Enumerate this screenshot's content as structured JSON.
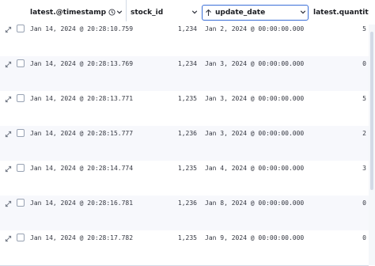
{
  "columns": {
    "timestamp": "latest.@timestamp",
    "stock_id": "stock_id",
    "update_date": "update_date",
    "quantity": "latest.quantity"
  },
  "sort": {
    "column": "update_date",
    "direction": "ascending"
  },
  "rows": [
    {
      "timestamp": "Jan 14, 2024 @ 20:28:10.759",
      "stock_id": "1,234",
      "update_date": "Jan 2, 2024 @ 00:00:00.000",
      "quantity": "5"
    },
    {
      "timestamp": "Jan 14, 2024 @ 20:28:13.769",
      "stock_id": "1,234",
      "update_date": "Jan 3, 2024 @ 00:00:00.000",
      "quantity": "0"
    },
    {
      "timestamp": "Jan 14, 2024 @ 20:28:13.771",
      "stock_id": "1,235",
      "update_date": "Jan 3, 2024 @ 00:00:00.000",
      "quantity": "5"
    },
    {
      "timestamp": "Jan 14, 2024 @ 20:28:15.777",
      "stock_id": "1,236",
      "update_date": "Jan 3, 2024 @ 00:00:00.000",
      "quantity": "2"
    },
    {
      "timestamp": "Jan 14, 2024 @ 20:28:14.774",
      "stock_id": "1,235",
      "update_date": "Jan 4, 2024 @ 00:00:00.000",
      "quantity": "3"
    },
    {
      "timestamp": "Jan 14, 2024 @ 20:28:16.781",
      "stock_id": "1,236",
      "update_date": "Jan 8, 2024 @ 00:00:00.000",
      "quantity": "0"
    },
    {
      "timestamp": "Jan 14, 2024 @ 20:28:17.782",
      "stock_id": "1,235",
      "update_date": "Jan 9, 2024 @ 00:00:00.000",
      "quantity": "0"
    }
  ],
  "colors": {
    "accent": "#3b6fd8",
    "border": "#d3dae6",
    "alt_row": "#f7f8fc"
  }
}
